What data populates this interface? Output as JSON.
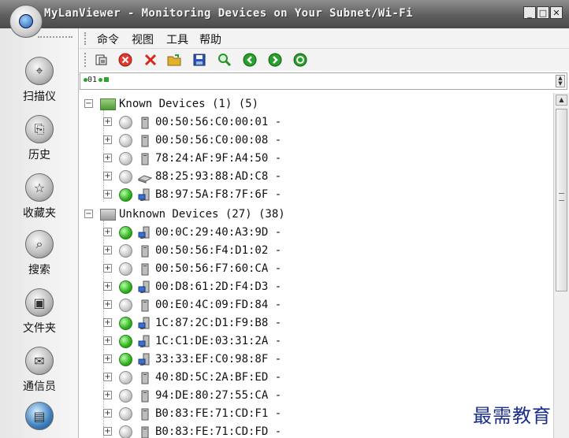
{
  "window": {
    "title": "MyLanViewer - Monitoring Devices on Your Subnet/Wi-Fi",
    "controls": [
      "minimize",
      "maximize",
      "close"
    ]
  },
  "menu": {
    "items": [
      "命令",
      "视图",
      "工具",
      "帮助"
    ]
  },
  "toolbar": {
    "buttons": [
      {
        "icon": "refresh-document-icon"
      },
      {
        "icon": "stop-red-circle-icon",
        "color": "#e03a2f"
      },
      {
        "icon": "delete-x-icon",
        "color": "#d8261b"
      },
      {
        "icon": "open-folder-icon",
        "color": "#e2b12c"
      },
      {
        "icon": "save-floppy-icon",
        "color": "#2b53b7"
      },
      {
        "icon": "search-magnifier-icon",
        "color": "#2a8f2a"
      },
      {
        "icon": "back-arrow-icon",
        "color": "#27a12a"
      },
      {
        "icon": "forward-arrow-icon",
        "color": "#27a12a"
      },
      {
        "icon": "refresh-cycle-icon",
        "color": "#27a12a"
      }
    ]
  },
  "address": {
    "text": "01"
  },
  "sidebar": {
    "items": [
      {
        "label": "扫描仪",
        "icon": "scanner-icon"
      },
      {
        "label": "历史",
        "icon": "history-door-icon"
      },
      {
        "label": "收藏夹",
        "icon": "favorites-star-icon"
      },
      {
        "label": "搜索",
        "icon": "search-icon"
      },
      {
        "label": "文件夹",
        "icon": "folder-icon"
      },
      {
        "label": "通信员",
        "icon": "messenger-chat-icon"
      },
      {
        "label": "",
        "icon": "subnet-monitor-icon"
      }
    ]
  },
  "tree": {
    "groups": [
      {
        "label": "Known Devices (1) (5)",
        "color": "green",
        "devices": [
          {
            "mac": "00:50:56:C0:00:01 -",
            "online": false,
            "type": "computer"
          },
          {
            "mac": "00:50:56:C0:00:08 -",
            "online": false,
            "type": "computer"
          },
          {
            "mac": "78:24:AF:9F:A4:50 -",
            "online": false,
            "type": "computer"
          },
          {
            "mac": "88:25:93:88:AD:C8 -",
            "online": false,
            "type": "router"
          },
          {
            "mac": "B8:97:5A:F8:7F:6F -",
            "online": true,
            "type": "network-pc"
          }
        ]
      },
      {
        "label": "Unknown Devices (27) (38)",
        "color": "gray",
        "devices": [
          {
            "mac": "00:0C:29:40:A3:9D -",
            "online": true,
            "type": "network-pc"
          },
          {
            "mac": "00:50:56:F4:D1:02 -",
            "online": false,
            "type": "computer"
          },
          {
            "mac": "00:50:56:F7:60:CA -",
            "online": false,
            "type": "computer"
          },
          {
            "mac": "00:D8:61:2D:F4:D3 -",
            "online": true,
            "type": "network-pc"
          },
          {
            "mac": "00:E0:4C:09:FD:84 -",
            "online": false,
            "type": "computer"
          },
          {
            "mac": "1C:87:2C:D1:F9:B8 -",
            "online": true,
            "type": "network-pc"
          },
          {
            "mac": "1C:C1:DE:03:31:2A -",
            "online": true,
            "type": "network-pc"
          },
          {
            "mac": "33:33:EF:C0:98:8F -",
            "online": true,
            "type": "network-pc"
          },
          {
            "mac": "40:8D:5C:2A:BF:ED -",
            "online": false,
            "type": "computer"
          },
          {
            "mac": "94:DE:80:27:55:CA -",
            "online": false,
            "type": "computer"
          },
          {
            "mac": "B0:83:FE:71:CD:F1 -",
            "online": false,
            "type": "computer"
          },
          {
            "mac": "B0:83:FE:71:CD:FD -",
            "online": false,
            "type": "computer"
          }
        ]
      }
    ]
  },
  "watermark": {
    "text": "最需教育"
  }
}
